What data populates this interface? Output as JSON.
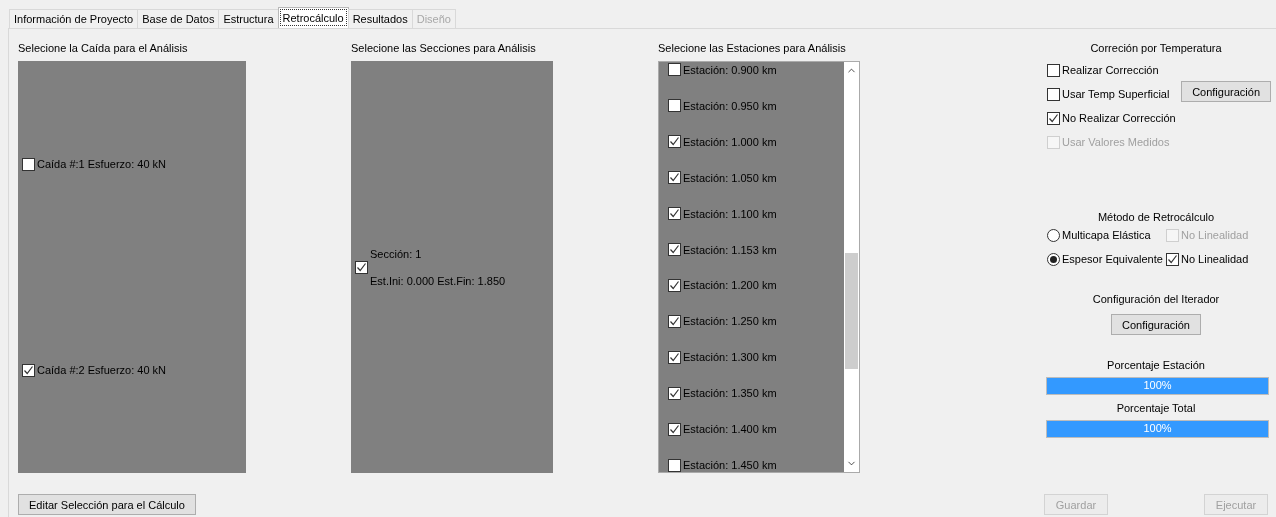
{
  "tabs": [
    {
      "label": "Información de Proyecto",
      "selected": false,
      "disabled": false
    },
    {
      "label": "Base de Datos",
      "selected": false,
      "disabled": false
    },
    {
      "label": "Estructura",
      "selected": false,
      "disabled": false
    },
    {
      "label": "Retrocálculo",
      "selected": true,
      "disabled": false
    },
    {
      "label": "Resultados",
      "selected": false,
      "disabled": false
    },
    {
      "label": "Diseño",
      "selected": false,
      "disabled": true
    }
  ],
  "drops": {
    "title": "Selecione la Caída para el Análisis",
    "items": [
      {
        "label": "Caída #:1 Esfuerzo: 40 kN",
        "checked": false
      },
      {
        "label": "Caída #:2 Esfuerzo: 40 kN",
        "checked": true
      }
    ]
  },
  "sections": {
    "title": "Selecione las Secciones para Análisis",
    "items": [
      {
        "name": "Sección: 1",
        "range": "Est.Ini: 0.000 Est.Fin: 1.850",
        "checked": true
      }
    ]
  },
  "stations": {
    "title": "Selecione las Estaciones para Análisis",
    "items": [
      {
        "label": "Estación: 0.900 km",
        "checked": false
      },
      {
        "label": "Estación: 0.950 km",
        "checked": false
      },
      {
        "label": "Estación: 1.000 km",
        "checked": true
      },
      {
        "label": "Estación: 1.050 km",
        "checked": true
      },
      {
        "label": "Estación: 1.100 km",
        "checked": true
      },
      {
        "label": "Estación: 1.153 km",
        "checked": true
      },
      {
        "label": "Estación: 1.200 km",
        "checked": true
      },
      {
        "label": "Estación: 1.250 km",
        "checked": true
      },
      {
        "label": "Estación: 1.300 km",
        "checked": true
      },
      {
        "label": "Estación: 1.350 km",
        "checked": true
      },
      {
        "label": "Estación: 1.400 km",
        "checked": true
      },
      {
        "label": "Estación: 1.450 km",
        "checked": false
      }
    ]
  },
  "temperature": {
    "title": "Correción por Temperatura",
    "options": [
      {
        "label": "Realizar Corrección",
        "checked": false,
        "disabled": false
      },
      {
        "label": "Usar Temp Superficial",
        "checked": false,
        "disabled": false
      },
      {
        "label": "No Realizar Corrección",
        "checked": true,
        "disabled": false
      },
      {
        "label": "Usar Valores Medidos",
        "checked": false,
        "disabled": true
      }
    ],
    "button": "Configuración"
  },
  "method": {
    "title": "Método de Retrocálculo",
    "rows": [
      {
        "label": "Multicapa Elástica",
        "selected": false,
        "option": {
          "label": "No Linealidad",
          "checked": false,
          "disabled": true
        }
      },
      {
        "label": "Espesor Equivalente",
        "selected": true,
        "option": {
          "label": "No Linealidad",
          "checked": true,
          "disabled": false
        }
      }
    ]
  },
  "iterator": {
    "title": "Configuración del Iterador",
    "button": "Configuración"
  },
  "progress": [
    {
      "title": "Porcentaje Estación",
      "level": 1,
      "text": "100%"
    },
    {
      "title": "Porcentaje Total",
      "level": 1,
      "text": "100%"
    }
  ],
  "bottom": {
    "edit_button": "Editar Selección para el Cálculo",
    "buttons": [
      {
        "label": "Guardar",
        "disabled": true
      },
      {
        "label": "Ejecutar",
        "disabled": true
      }
    ]
  }
}
